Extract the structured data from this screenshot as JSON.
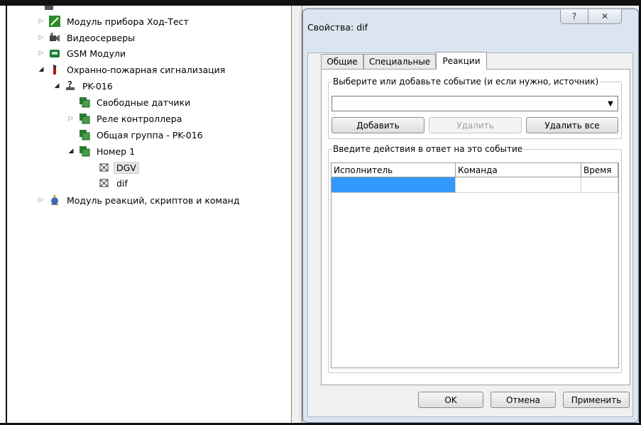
{
  "tree": {
    "items": [
      {
        "label": "Модуль прибора Ход-Тест",
        "icon": "module-green-icon"
      },
      {
        "label": "Видеосерверы",
        "icon": "video-server-icon"
      },
      {
        "label": "GSM Модули",
        "icon": "gsm-module-icon"
      },
      {
        "label": "Охранно-пожарная сигнализация",
        "icon": "fire-alarm-icon"
      },
      {
        "label": "PK-016",
        "icon": "device-icon"
      },
      {
        "label": "Свободные датчики",
        "icon": "sensor-group-icon"
      },
      {
        "label": "Реле контроллера",
        "icon": "sensor-group-icon"
      },
      {
        "label": "Общая группа - PK-016",
        "icon": "sensor-group-icon"
      },
      {
        "label": "Номер 1",
        "icon": "sensor-group-icon"
      },
      {
        "label": "DGV",
        "icon": "sensor-icon"
      },
      {
        "label": "dif",
        "icon": "sensor-icon"
      },
      {
        "label": "Модуль реакций, скриптов и команд",
        "icon": "script-module-icon"
      }
    ]
  },
  "dialog": {
    "title": "Свойства: dif",
    "help_glyph": "?",
    "close_glyph": "✕",
    "tabs": [
      "Общие",
      "Специальные",
      "Реакции"
    ],
    "active_tab": "Реакции",
    "event_group_label": "Выберите или добавьте событие (и если нужно, источник)",
    "event_combo_value": "",
    "add_button": "Добавить",
    "delete_button": "Удалить",
    "delete_all_button": "Удалить все",
    "actions_group_label": "Введите действия в ответ на это событие",
    "columns": [
      "Исполнитель",
      "Команда",
      "Время"
    ],
    "ok_button": "OK",
    "cancel_button": "Отмена",
    "apply_button": "Применить",
    "selection_color": "#3399ff"
  }
}
